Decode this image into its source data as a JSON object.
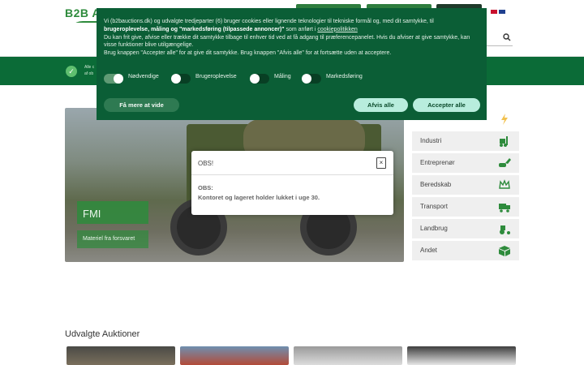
{
  "header": {
    "logo_text": "B2B A",
    "flag_dk": "dk-flag",
    "flag_gb": "gb-flag"
  },
  "band": {
    "text_line1": "Alle c",
    "text_line2": "af ob"
  },
  "hero": {
    "title": "FMI",
    "subtitle": "Materiel fra forsvaret"
  },
  "categories": [
    {
      "label": "Industri",
      "icon": "forklift-icon"
    },
    {
      "label": "Entreprenør",
      "icon": "excavator-icon"
    },
    {
      "label": "Beredskab",
      "icon": "crown-icon"
    },
    {
      "label": "Transport",
      "icon": "truck-icon"
    },
    {
      "label": "Landbrug",
      "icon": "tractor-icon"
    },
    {
      "label": "Andet",
      "icon": "box-icon"
    }
  ],
  "section": {
    "title": "Udvalgte Auktioner"
  },
  "cookie": {
    "line1_a": "Vi (b2bauctions.dk) og udvalgte tredjeparter (6) bruger cookies eller lignende teknologier til tekniske formål og, med dit samtykke, til ",
    "line1_bold": "brugeroplevelse, måling og \"markedsføring (tilpassede annoncer)\"",
    "line1_b": " som anført i ",
    "link": "cookiepolitikken",
    "line2": "Du kan frit give, afvise eller trække dit samtykke tilbage til enhver tid ved at få adgang til præferencepanelet. Hvis du afviser at give samtykke, kan visse funktioner blive utilgængelige.",
    "line3": "Brug knappen \"Accepter alle\" for at give dit samtykke. Brug knappen \"Afvis alle\" for at fortsætte uden at acceptere.",
    "toggles": [
      {
        "label": "Nødvendige",
        "on": true
      },
      {
        "label": "Brugeroplevelse",
        "on": false
      },
      {
        "label": "Måling",
        "on": false
      },
      {
        "label": "Markedsføring",
        "on": false
      }
    ],
    "learn_more": "Få mere at vide",
    "reject_all": "Afvis alle",
    "accept_all": "Accepter alle"
  },
  "modal": {
    "title": "OBS!",
    "close": "×",
    "body_line1": "OBS:",
    "body_line2": "Kontoret og lageret holder lukket i uge 30."
  },
  "colors": {
    "brand_green": "#0b6b37",
    "cookie_bg": "#0b5e36",
    "accent_mint": "#b8eddd"
  }
}
